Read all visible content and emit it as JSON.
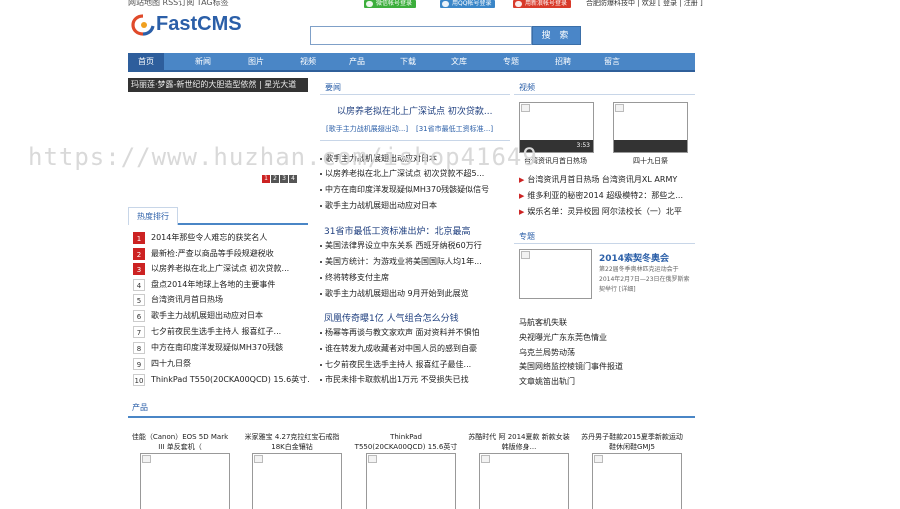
{
  "topbar": {
    "left_text": "网站地图 RSS订阅 TAG标签",
    "login_buttons": [
      {
        "label": "微信帐号登录",
        "color": "#3cae3c"
      },
      {
        "label": "用QQ帐号登录",
        "color": "#3a86c8"
      },
      {
        "label": "用新浪帐号登录",
        "color": "#d83a2a"
      }
    ],
    "right_text": "合肥防爆科技中 | 欢迎 [ 登录 | 注册 ]"
  },
  "header": {
    "logo_text": "FastCMS",
    "search_placeholder": "",
    "search_button": "搜 索"
  },
  "nav": {
    "items": [
      "首页",
      "新闻",
      "图片",
      "视频",
      "产品",
      "下载",
      "文库",
      "专题",
      "招聘",
      "留言"
    ],
    "active_index": 0
  },
  "slider": {
    "caption": "玛丽莲·梦露-新世纪的大胆造型依然 | 星光大道",
    "pages": [
      "1",
      "2",
      "3",
      "4"
    ],
    "active_page": 0
  },
  "rank": {
    "title": "热度排行",
    "items": [
      {
        "n": "1",
        "title": "2014年那些令人难忘的获奖名人"
      },
      {
        "n": "2",
        "title": "最新检:严查以商品等手段规避税收"
      },
      {
        "n": "3",
        "title": "以房养老拟在北上广深试点 初次贷款..."
      },
      {
        "n": "4",
        "title": "盘点2014年地球上各地的主要事件"
      },
      {
        "n": "5",
        "title": "台湾资讯月首日热场"
      },
      {
        "n": "6",
        "title": "歌手主力战机展翅出动应对日本"
      },
      {
        "n": "7",
        "title": "七夕前夜民生选手主持人 报喜红子..."
      },
      {
        "n": "8",
        "title": "中方在南印度洋发现疑似MH370残骸"
      },
      {
        "n": "9",
        "title": "四十九日祭"
      },
      {
        "n": "10",
        "title": "ThinkPad T550(20CKA00QCD) 15.6英寸..."
      }
    ]
  },
  "news": {
    "title": "要闻",
    "headline": "以房养老拟在北上广深试点 初次贷款...",
    "sub_links": [
      "[歌手主力战机展翅出动...]",
      "[31省市最低工资标准...]"
    ],
    "group1": [
      "歌手主力战机展翅出动应对日本",
      "以房养老拟在北上广深试点 初次贷款不超5...",
      "中方在南印度洋发现疑似MH370残骸疑似信号",
      "歌手主力战机展翅出动应对日本"
    ],
    "headline2": "31省市最低工资标准出炉：北京最高",
    "group2": [
      "美国法律界设立中东关系 西班牙纳税60万行",
      "美国方统计：为游戏业将美国国际人均1年...",
      "终将转移支付主席",
      "歌手主力战机展翅出动 9月开始到此展览"
    ],
    "headline3": "凤凰传奇曝1亿 人气组合怎么分钱",
    "group3": [
      "杨幂等再谈与教文家欢声 面对资料并不惧怕",
      "谁在转发九成收藏者对中国人员的感到自豪",
      "七夕前夜民生选手主持人 报喜红子最佳...",
      "市民未排卡取款机出1万元 不受损失已找"
    ]
  },
  "video": {
    "title": "视频",
    "thumbs": [
      {
        "caption": "台湾资讯月首日热场",
        "duration": "3:53"
      },
      {
        "caption": "四十九日祭",
        "duration": ""
      }
    ],
    "links": [
      "台湾资讯月首日热场  台湾资讯月XL ARMY",
      "维多利亚的秘密2014  超级模特2：那些之...",
      "娱乐名单：灵异校园  阿尔法校长（一）北平"
    ]
  },
  "special": {
    "title": "专题",
    "feature_title": "2014索契冬奥会",
    "feature_desc": "第22届冬季奥林匹克运动会于2014年2月7日—23日在俄罗斯索契举行 [详细]",
    "links": [
      "马航客机失联",
      "央视曝光广东东莞色情业",
      "乌克兰局势动荡",
      "美国网络监控棱镜门事件报道",
      "文章姚笛出轨门"
    ]
  },
  "products": {
    "title": "产品",
    "items": [
      "佳能（Canon）EOS 5D Mark III 单反套机（",
      "米家雅宝 4.27克拉红宝石戒指 18K白金镶钻",
      "ThinkPad T550(20CKA00QCD) 15.6英寸笔记本",
      "苏酷时代 阿 2014夏款 新款女装 韩版修身...",
      "苏丹男子鞋款2015夏季新款运动鞋休闲鞋GMJ5"
    ]
  },
  "watermark": "https://www.huzhan.com/ishop41649"
}
